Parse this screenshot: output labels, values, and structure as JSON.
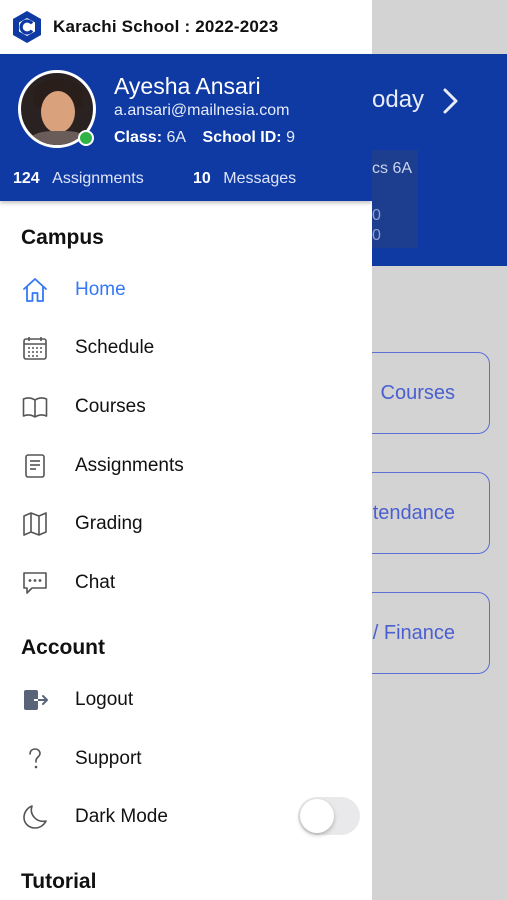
{
  "header": {
    "school_name": "Karachi School : 2022-2023"
  },
  "profile": {
    "name": "Ayesha Ansari",
    "email": "a.ansari@mailnesia.com",
    "class_label": "Class:",
    "class_value": "6A",
    "school_id_label": "School ID:",
    "school_id_value": "9",
    "assignments_count": "124",
    "assignments_label": "Assignments",
    "messages_count": "10",
    "messages_label": "Messages",
    "status": "online"
  },
  "campus": {
    "title": "Campus",
    "items": [
      {
        "label": "Home",
        "icon": "home-icon",
        "active": true
      },
      {
        "label": "Schedule",
        "icon": "calendar-icon"
      },
      {
        "label": "Courses",
        "icon": "book-icon"
      },
      {
        "label": "Assignments",
        "icon": "document-icon"
      },
      {
        "label": "Grading",
        "icon": "map-icon"
      },
      {
        "label": "Chat",
        "icon": "chat-icon"
      }
    ]
  },
  "account": {
    "title": "Account",
    "items": [
      {
        "label": "Logout",
        "icon": "logout-icon"
      },
      {
        "label": "Support",
        "icon": "question-icon"
      },
      {
        "label": "Dark Mode",
        "icon": "moon-icon",
        "toggle": false
      }
    ]
  },
  "tutorial": {
    "title": "Tutorial"
  },
  "background": {
    "today_text": "oday",
    "card_text": "cs 6A",
    "card_lines": [
      "0",
      "0"
    ],
    "buttons": [
      "Courses",
      "tendance",
      "/ Finance"
    ]
  },
  "colors": {
    "primary": "#0f3aa3",
    "active": "#3478f6",
    "online": "#2fb344"
  }
}
